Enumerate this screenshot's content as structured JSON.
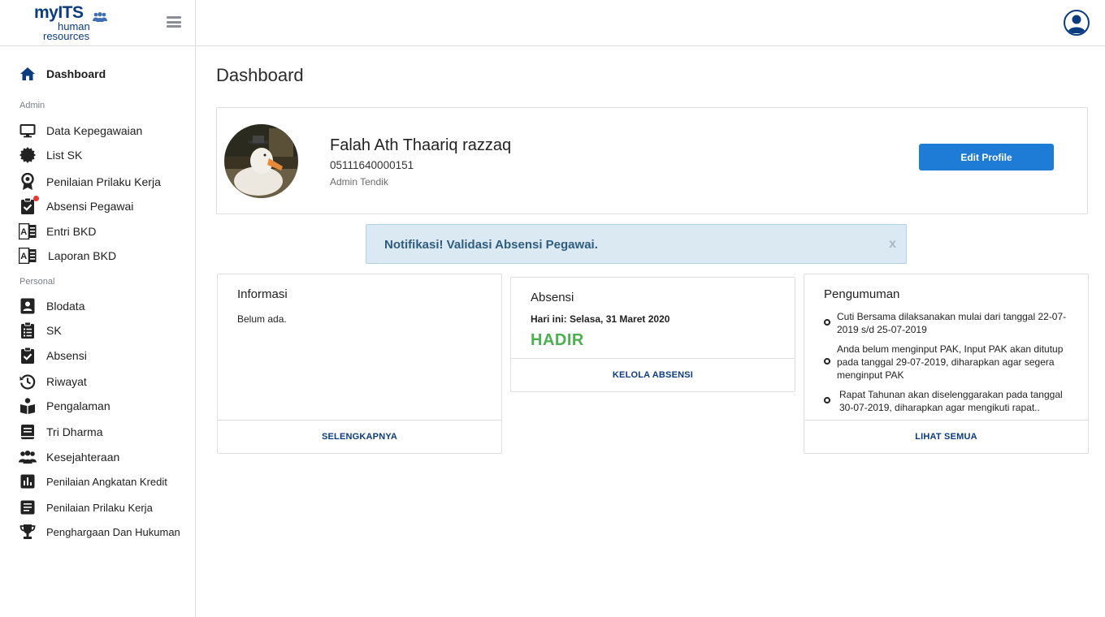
{
  "app": {
    "logo_my": "myITS",
    "logo_line1": "human",
    "logo_line2": "resources"
  },
  "sidebar": {
    "dashboard": "Dashboard",
    "section_admin": "Admin",
    "admin_items": [
      {
        "label": "Data Kepegawaian",
        "icon": "monitor-icon"
      },
      {
        "label": "List SK",
        "icon": "certificate-icon"
      },
      {
        "label": "Penilaian Prilaku Kerja",
        "icon": "award-icon"
      },
      {
        "label": "Absensi Pegawai",
        "icon": "clipboard-check-icon"
      },
      {
        "label": "Entri BKD",
        "icon": "translate-book-icon"
      },
      {
        "label": "Laporan BKD",
        "icon": "translate-book-icon"
      }
    ],
    "section_personal": "Personal",
    "personal_items": [
      {
        "label": "Blodata",
        "icon": "id-card-icon"
      },
      {
        "label": "SK",
        "icon": "list-clipboard-icon"
      },
      {
        "label": "Absensi",
        "icon": "clipboard-check-icon"
      },
      {
        "label": "Riwayat",
        "icon": "history-icon"
      },
      {
        "label": "Pengalaman",
        "icon": "reader-icon"
      },
      {
        "label": "Tri Dharma",
        "icon": "book-icon"
      },
      {
        "label": "Kesejahteraan",
        "icon": "group-icon"
      },
      {
        "label": "Penilaian Angkatan Kredit",
        "icon": "bar-chart-icon"
      },
      {
        "label": "Penilaian Prilaku Kerja",
        "icon": "document-icon"
      },
      {
        "label": "Penghargaan Dan Hukuman",
        "icon": "trophy-icon"
      }
    ]
  },
  "main": {
    "title": "Dashboard",
    "profile": {
      "name": "Falah Ath Thaariq razzaq",
      "nip": "05111640000151",
      "role": "Admin Tendik",
      "edit_label": "Edit Profile"
    },
    "notification": {
      "text": "Notifikasi! Validasi Absensi Pegawai.",
      "close": "x"
    },
    "informasi": {
      "title": "Informasi",
      "body": "Belum ada.",
      "footer": "SELENGKAPNYA"
    },
    "absensi": {
      "title": "Absensi",
      "today": "Hari ini: Selasa, 31 Maret 2020",
      "status": "HADIR",
      "footer": "KELOLA ABSENSI"
    },
    "pengumuman": {
      "title": "Pengumuman",
      "items": [
        "Cuti Bersama dilaksanakan mulai dari tanggal 22-07-2019 s/d 25-07-2019",
        "Anda belum menginput PAK, Input PAK akan ditutup pada tanggal 29-07-2019, diharapkan agar segera menginput PAK",
        "Rapat Tahunan akan diselenggarakan pada tanggal 30-07-2019, diharapkan agar mengikuti rapat.."
      ],
      "footer": "LIHAT SEMUA"
    }
  },
  "colors": {
    "brand": "#0b3c80",
    "primary_button": "#1e7bd6",
    "status_ok": "#4caf50",
    "notif_bg": "#dbe9f3",
    "badge_red": "#e53935"
  }
}
